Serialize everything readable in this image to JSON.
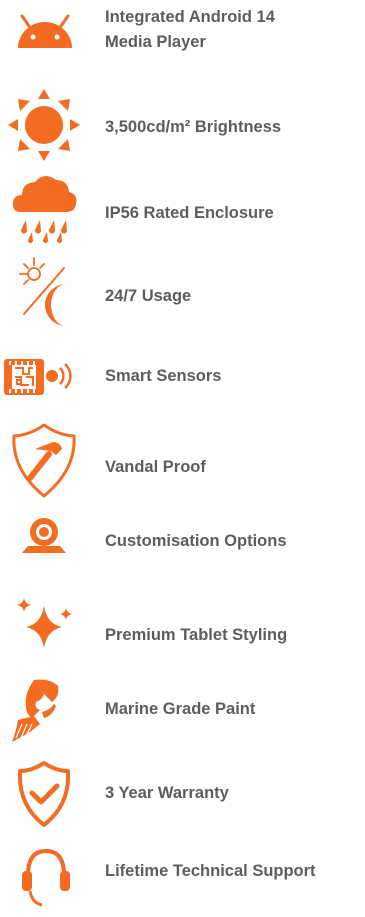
{
  "colors": {
    "accent": "#f36c21",
    "text": "#5d5d5d"
  },
  "features": [
    {
      "icon": "android-icon",
      "label_line1": "Integrated Android 14",
      "label_line2": "Media Player"
    },
    {
      "icon": "sun-icon",
      "label": "3,500cd/m² Brightness"
    },
    {
      "icon": "rain-cloud-icon",
      "label": "IP56 Rated Enclosure"
    },
    {
      "icon": "sun-moon-icon",
      "label": "24/7 Usage"
    },
    {
      "icon": "sensor-chip-icon",
      "label": "Smart Sensors"
    },
    {
      "icon": "shield-hammer-icon",
      "label": "Vandal Proof"
    },
    {
      "icon": "webcam-icon",
      "label": "Customisation Options"
    },
    {
      "icon": "sparkle-icon",
      "label": "Premium Tablet Styling"
    },
    {
      "icon": "paint-brush-icon",
      "label": "Marine Grade Paint"
    },
    {
      "icon": "shield-check-icon",
      "label": "3 Year Warranty"
    },
    {
      "icon": "headset-icon",
      "label": "Lifetime Technical Support"
    }
  ]
}
